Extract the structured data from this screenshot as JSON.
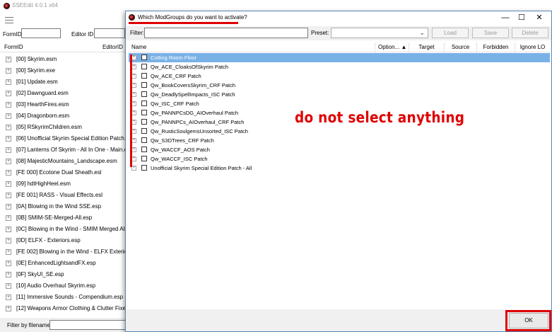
{
  "main_window": {
    "title": "SSEEdit 4.0.1 x64",
    "form_id_label": "FormID",
    "editor_id_label": "Editor ID",
    "columns": {
      "form_id": "FormID",
      "editor_id": "EditorID"
    },
    "tree_items": [
      "[00] Skyrim.esm",
      "[00] Skyrim.exe",
      "[01] Update.esm",
      "[02] Dawnguard.esm",
      "[03] HearthFires.esm",
      "[04] Dragonborn.esm",
      "[05] RSkyrimChildren.esm",
      "[06] Unofficial Skyrim Special Edition Patch.esp",
      "[07] Lanterns Of Skyrim - All In One - Main.esm",
      "[08] MajesticMountains_Landscape.esm",
      "[FE 000] Ecotone Dual Sheath.esl",
      "[09] hdtHighHeel.esm",
      "[FE 001] RASS - Visual Effects.esl",
      "[0A] Blowing in the Wind SSE.esp",
      "[0B] SMIM-SE-Merged-All.esp",
      "[0C] Blowing in the Wind - SMIM Merged All P",
      "[0D] ELFX - Exteriors.esp",
      "[FE 002] Blowing in the Wind - ELFX Exterior pa",
      "[0E] EnhancedLightsandFX.esp",
      "[0F] SkyUI_SE.esp",
      "[10] Audio Overhaul Skyrim.esp",
      "[11] Immersive Sounds - Compendium.esp",
      "[12] Weapons Armor Clothing & Clutter Fixes.e"
    ],
    "filter_label": "Filter by filename:"
  },
  "dialog": {
    "title": "Which ModGroups do you want to activate?",
    "window_buttons": {
      "minimize": "—",
      "maximize": "☐",
      "close": "✕"
    },
    "filter_label": "Filter:",
    "preset_label": "Preset:",
    "buttons": {
      "load": "Load",
      "save": "Save",
      "delete": "Delete"
    },
    "columns": [
      "Name",
      "Option... ▲",
      "Target",
      "Source",
      "Forbidden",
      "Ignore LO"
    ],
    "rows": [
      "Cutting Room Floor",
      "Qw_ACE_CloaksOfSkyrim Patch",
      "Qw_ACE_CRF Patch",
      "Qw_BookCoversSkyrim_CRF Patch",
      "Qw_DeadlySpellImpacts_ISC Patch",
      "Qw_ISC_CRF Patch",
      "Qw_PANNPCsDG_AIOverhaul Patch",
      "Qw_PANNPCs_AIOverhaul_CRF Patch",
      "Qw_RusticSoulgemsUnsorted_ISC Patch",
      "Qw_S3DTrees_CRF Patch",
      "Qw_WACCF_AOS Patch",
      "Qw_WACCF_ISC Patch",
      "Unofficial Skyrim Special Edition Patch - All"
    ],
    "annotation": "do not select anything",
    "ok_label": "OK"
  },
  "colors": {
    "highlight_red": "#e00000",
    "selection_blue": "#79b1e6"
  }
}
